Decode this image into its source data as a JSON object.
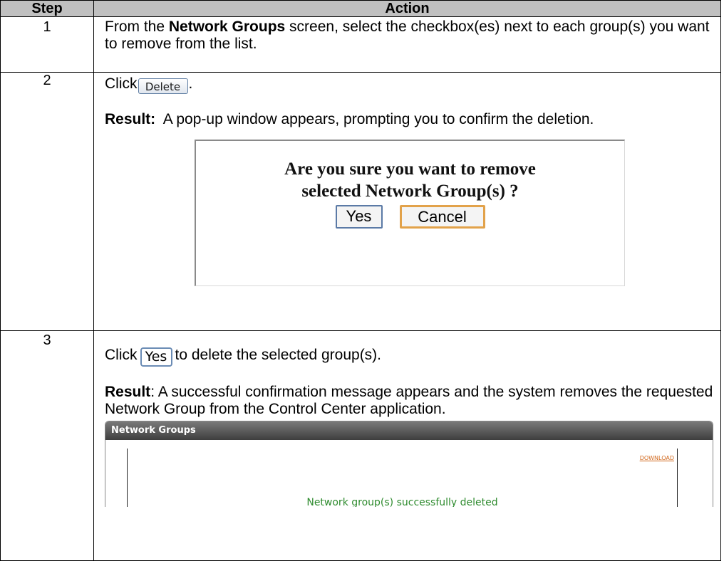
{
  "header": {
    "step": "Step",
    "action": "Action"
  },
  "steps": [
    {
      "number": "1",
      "text_pre": "From the ",
      "text_bold": "Network Groups",
      "text_post": " screen, select the checkbox(es) next to each group(s) you want to remove from the list."
    },
    {
      "number": "2",
      "click_label": "Click",
      "button_label": "Delete",
      "after_button": ".",
      "result_label": "Result:",
      "result_text": "  A pop-up window appears, prompting you to confirm the deletion.",
      "popup": {
        "message_line1": "Are you sure you want to remove",
        "message_line2": "selected Network Group(s) ?",
        "yes_label": "Yes",
        "cancel_label": "Cancel"
      }
    },
    {
      "number": "3",
      "click_label": "Click",
      "button_label": "Yes",
      "after_button": "to delete the selected group(s).",
      "result_label": "Result",
      "result_text": ": A successful confirmation message appears and the system removes the requested Network Group from the Control Center application.",
      "panel": {
        "title": "Network Groups",
        "download_label": "DOWNLOAD",
        "success_message": "Network group(s) successfully deleted"
      }
    }
  ],
  "colors": {
    "header_bg": "#c0c0c0",
    "success_text": "#2e8b2e",
    "download_link": "#d2691e",
    "cancel_border": "#e2a24a"
  }
}
